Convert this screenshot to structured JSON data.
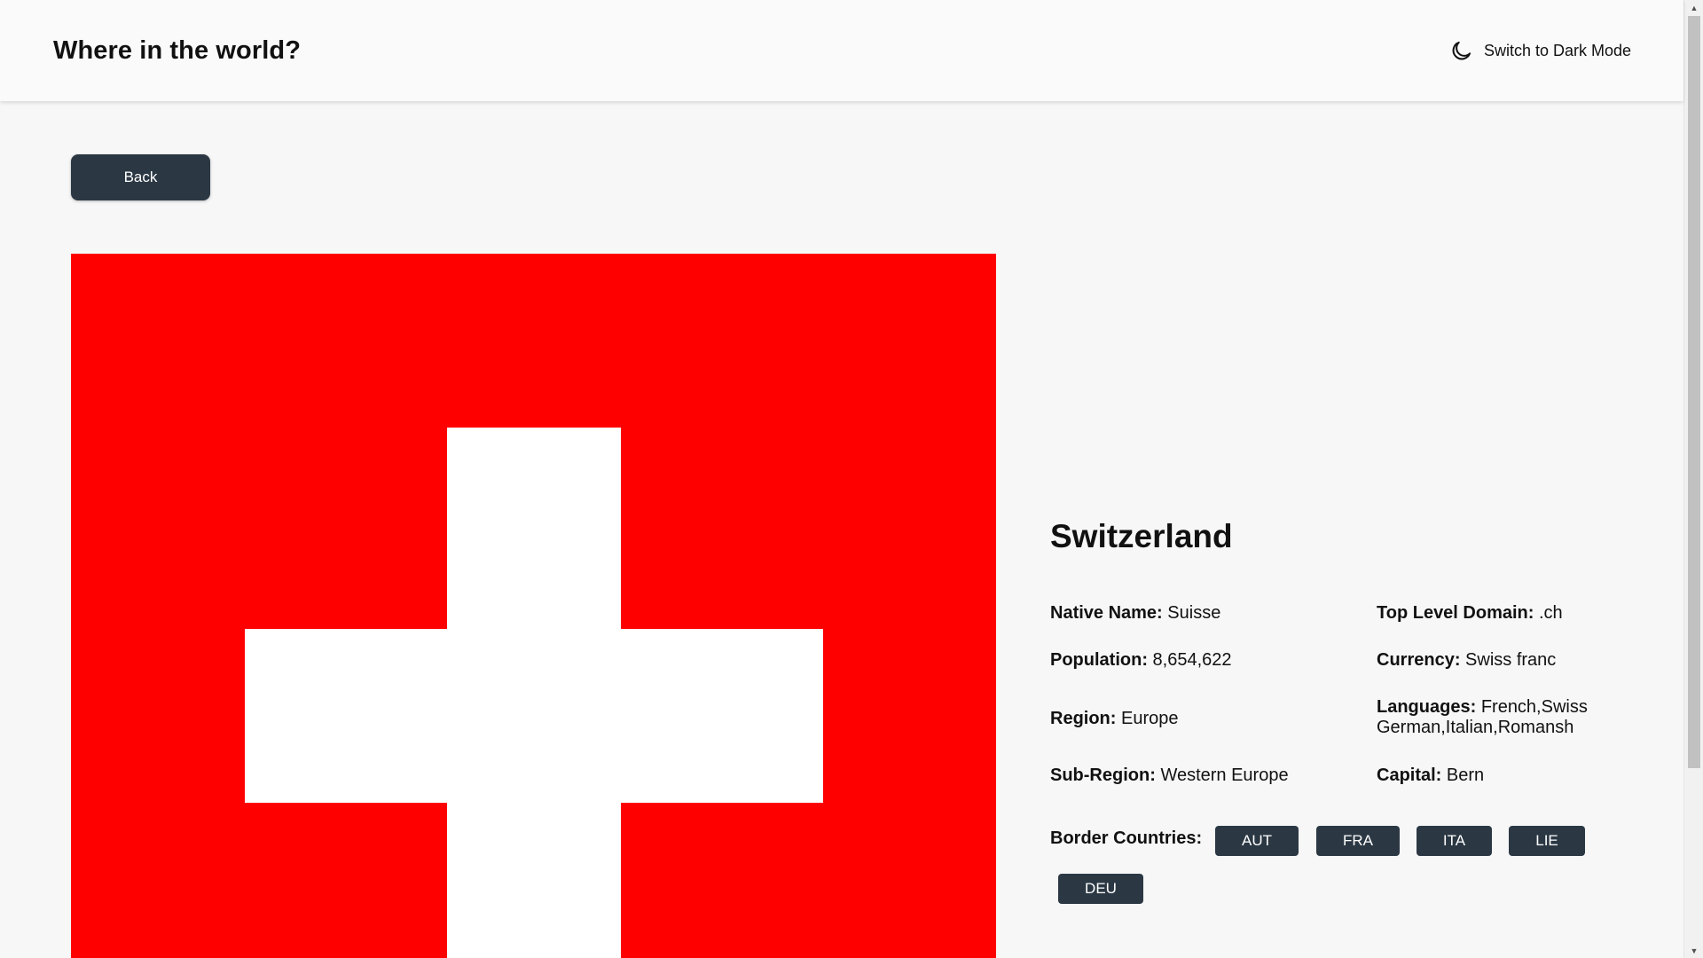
{
  "header": {
    "title": "Where in the world?",
    "theme_toggle_label": "Switch to Dark Mode",
    "theme_icon": "moon-icon"
  },
  "back_button": {
    "label": "Back"
  },
  "flag": {
    "name": "swiss-flag",
    "colors": {
      "field": "#ff0000",
      "cross": "#ffffff"
    }
  },
  "country": {
    "name": "Switzerland",
    "native_name": {
      "label": "Native Name:",
      "value": "Suisse"
    },
    "population": {
      "label": "Population:",
      "value": "8,654,622"
    },
    "region": {
      "label": "Region:",
      "value": "Europe"
    },
    "sub_region": {
      "label": "Sub-Region:",
      "value": "Western Europe"
    },
    "top_level_domain": {
      "label": "Top Level Domain:",
      "value": ".ch"
    },
    "currency": {
      "label": "Currency:",
      "value": "Swiss franc"
    },
    "languages": {
      "label": "Languages:",
      "value": "French,Swiss German,Italian,Romansh"
    },
    "capital": {
      "label": "Capital:",
      "value": "Bern"
    },
    "border_countries_label": "Border Countries:",
    "border_countries": [
      "AUT",
      "FRA",
      "ITA",
      "LIE",
      "DEU"
    ]
  },
  "colors": {
    "background": "#f7f7f7",
    "header_background": "#fafafa",
    "button": "#2b3844",
    "button_text": "#ffffff",
    "text": "#111111"
  }
}
